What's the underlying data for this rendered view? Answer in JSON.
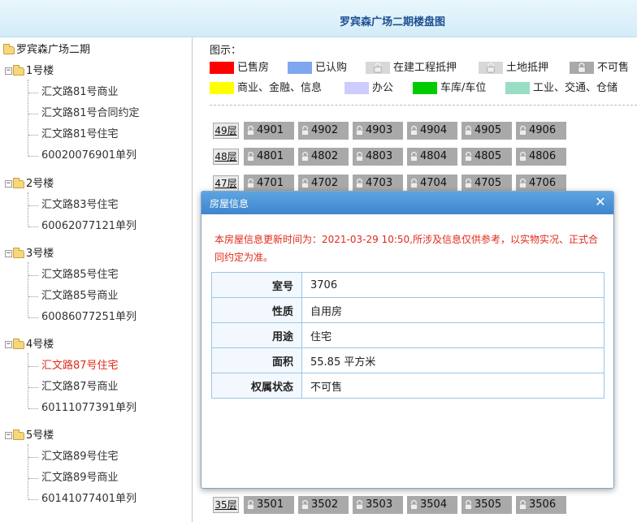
{
  "header": {
    "title": "罗宾森广场二期楼盘图"
  },
  "tree": {
    "root": "罗宾森广场二期",
    "buildings": [
      {
        "label": "1号楼",
        "items": [
          "汇文路81号商业",
          "汇文路81号合同约定",
          "汇文路81号住宅",
          "60020076901单列"
        ]
      },
      {
        "label": "2号楼",
        "items": [
          "汇文路83号住宅",
          "60062077121单列"
        ]
      },
      {
        "label": "3号楼",
        "items": [
          "汇文路85号住宅",
          "汇文路85号商业",
          "60086077251单列"
        ]
      },
      {
        "label": "4号楼",
        "items": [
          "汇文路87号住宅",
          "汇文路87号商业",
          "60111077391单列"
        ]
      },
      {
        "label": "5号楼",
        "items": [
          "汇文路89号住宅",
          "汇文路89号商业",
          "60141077401单列"
        ]
      }
    ],
    "selected": "汇文路87号住宅",
    "expander_symbol": "−"
  },
  "legend": {
    "title": "图示：",
    "items": [
      {
        "label": "已售房",
        "color": "#ff0000",
        "icon": ""
      },
      {
        "label": "已认购",
        "color": "#7fa7f0",
        "icon": ""
      },
      {
        "label": "在建工程抵押",
        "color": "#d8d8d8",
        "icon": "lock-icon"
      },
      {
        "label": "土地抵押",
        "color": "#d8d8d8",
        "icon": "lock-icon"
      },
      {
        "label": "不可售",
        "color": "#a9a9a9",
        "icon": "lock-icon"
      },
      {
        "label": "商业、金融、信息",
        "color": "#ffff00",
        "icon": ""
      },
      {
        "label": "办公",
        "color": "#ccccff",
        "icon": ""
      },
      {
        "label": "车库/车位",
        "color": "#00cc00",
        "icon": ""
      },
      {
        "label": "工业、交通、仓储",
        "color": "#99ddc4",
        "icon": ""
      }
    ]
  },
  "floors": [
    {
      "label": "49层",
      "units": [
        "4901",
        "4902",
        "4903",
        "4904",
        "4905",
        "4906"
      ]
    },
    {
      "label": "48层",
      "units": [
        "4801",
        "4802",
        "4803",
        "4804",
        "4805",
        "4806"
      ]
    },
    {
      "label": "47层",
      "units": [
        "4701",
        "4702",
        "4703",
        "4704",
        "4705",
        "4706"
      ]
    },
    {
      "label": "35层",
      "units": [
        "3501",
        "3502",
        "3503",
        "3504",
        "3505",
        "3506"
      ]
    }
  ],
  "unit_color": "#a9a9a9",
  "modal": {
    "title": "房屋信息",
    "close": "✕",
    "notice": "本房屋信息更新时间为：2021-03-29 10:50,所涉及信息仅供参考，以实物实况、正式合同约定为准。",
    "rows": [
      {
        "key": "室号",
        "value": "3706"
      },
      {
        "key": "性质",
        "value": "自用房"
      },
      {
        "key": "用途",
        "value": "住宅"
      },
      {
        "key": "面积",
        "value": "55.85 平方米"
      },
      {
        "key": "权属状态",
        "value": "不可售"
      }
    ]
  }
}
